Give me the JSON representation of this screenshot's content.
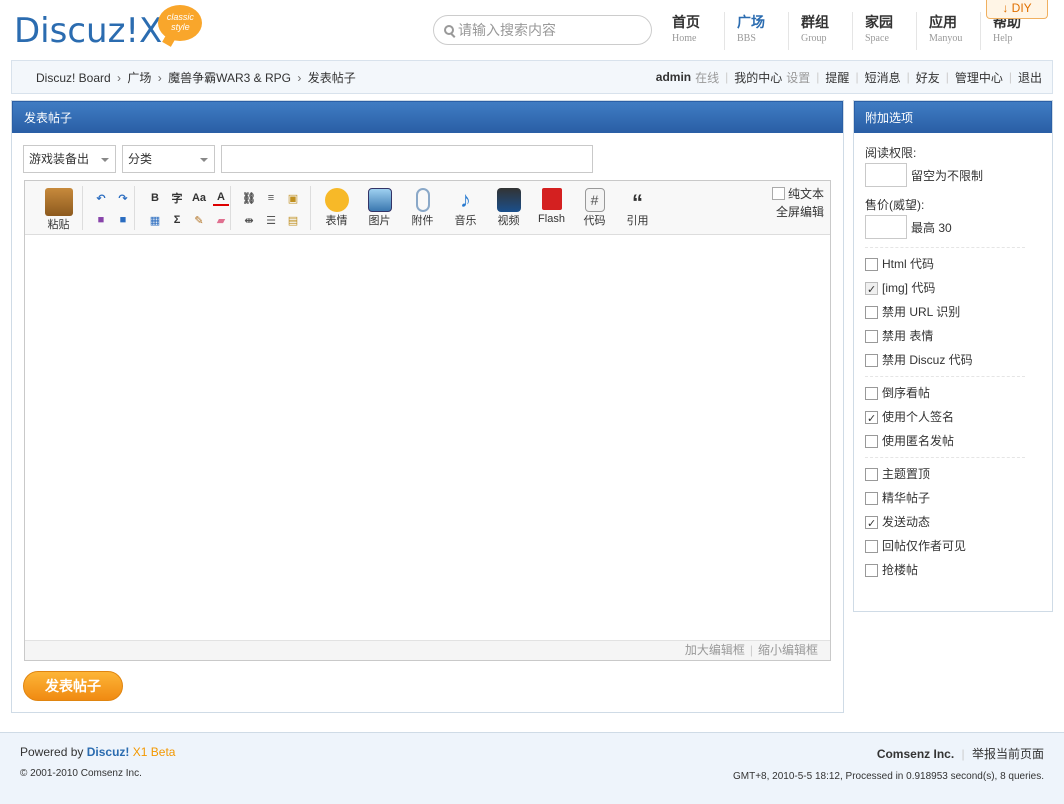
{
  "header": {
    "logo_text": "Discuz!X",
    "logo_badge": "classic style",
    "search_placeholder": "请输入搜索内容",
    "diy_label": "DIY",
    "nav": [
      {
        "zh": "首页",
        "en": "Home"
      },
      {
        "zh": "广场",
        "en": "BBS"
      },
      {
        "zh": "群组",
        "en": "Group"
      },
      {
        "zh": "家园",
        "en": "Space"
      },
      {
        "zh": "应用",
        "en": "Manyou"
      },
      {
        "zh": "帮助",
        "en": "Help"
      }
    ]
  },
  "breadcrumb": {
    "items": [
      "Discuz! Board",
      "广场",
      "魔兽争霸WAR3 & RPG",
      "发表帖子"
    ],
    "separator": "›"
  },
  "userbar": {
    "username": "admin",
    "status": "在线",
    "my_center": "我的中心",
    "settings": "设置",
    "remind": "提醒",
    "messages": "短消息",
    "friends": "好友",
    "admin_center": "管理中心",
    "logout": "退出"
  },
  "post": {
    "panel_title": "发表帖子",
    "forum_select": "游戏装备出",
    "category_select": "分类",
    "title_value": "",
    "toolbar": {
      "paste": "粘贴",
      "bold": "B",
      "font": "字",
      "size": "Aa",
      "color": "A",
      "sum": "Σ",
      "media": [
        {
          "label": "表情",
          "icon": "smiley-icon"
        },
        {
          "label": "图片",
          "icon": "image-icon"
        },
        {
          "label": "附件",
          "icon": "paperclip-icon"
        },
        {
          "label": "音乐",
          "icon": "music-note-icon"
        },
        {
          "label": "视频",
          "icon": "video-icon"
        },
        {
          "label": "Flash",
          "icon": "flash-icon"
        },
        {
          "label": "代码",
          "icon": "code-icon"
        },
        {
          "label": "引用",
          "icon": "quote-icon"
        }
      ],
      "plain_text": "纯文本",
      "fullscreen": "全屏编辑"
    },
    "footer": {
      "enlarge": "加大编辑框",
      "shrink": "缩小编辑框"
    },
    "submit": "发表帖子"
  },
  "side": {
    "panel_title": "附加选项",
    "read_perm_label": "阅读权限:",
    "read_perm_hint": "留空为不限制",
    "price_label": "售价(威望):",
    "price_hint": "最高 30",
    "options_group1": [
      {
        "label": "Html 代码",
        "checked": false,
        "disabled": false
      },
      {
        "label": "[img] 代码",
        "checked": true,
        "disabled": true
      },
      {
        "label": "禁用 URL 识别",
        "checked": false,
        "disabled": false
      },
      {
        "label": "禁用 表情",
        "checked": false,
        "disabled": false
      },
      {
        "label": "禁用 Discuz 代码",
        "checked": false,
        "disabled": false
      }
    ],
    "options_group2": [
      {
        "label": "倒序看帖",
        "checked": false
      },
      {
        "label": "使用个人签名",
        "checked": true
      },
      {
        "label": "使用匿名发帖",
        "checked": false
      }
    ],
    "options_group3": [
      {
        "label": "主题置顶",
        "checked": false
      },
      {
        "label": "精华帖子",
        "checked": false
      },
      {
        "label": "发送动态",
        "checked": true
      },
      {
        "label": "回帖仅作者可见",
        "checked": false
      },
      {
        "label": "抢楼帖",
        "checked": false
      }
    ]
  },
  "footer": {
    "powered_by": "Powered by",
    "brand": "Discuz!",
    "version": "X1 Beta",
    "copyright": "© 2001-2010 Comsenz Inc.",
    "company": "Comsenz Inc.",
    "report": "举报当前页面",
    "meta": "GMT+8, 2010-5-5 18:12, Processed in 0.918953 second(s), 8 queries."
  }
}
